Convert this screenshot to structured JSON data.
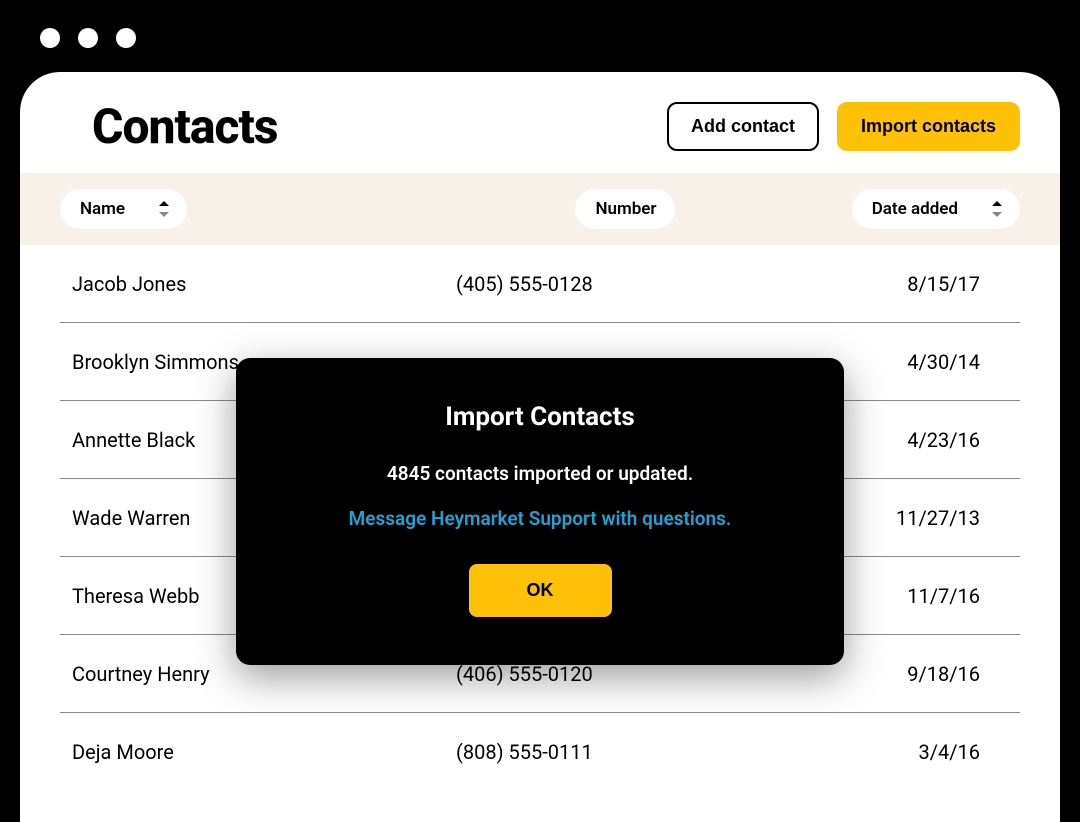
{
  "window": {
    "dots": 3
  },
  "header": {
    "title": "Contacts",
    "add_label": "Add contact",
    "import_label": "Import contacts"
  },
  "filters": {
    "name_label": "Name",
    "number_label": "Number",
    "date_label": "Date added"
  },
  "rows": [
    {
      "name": "Jacob Jones",
      "number": "(405) 555-0128",
      "date": "8/15/17"
    },
    {
      "name": "Brooklyn Simmons",
      "number": "",
      "date": "4/30/14"
    },
    {
      "name": "Annette Black",
      "number": "",
      "date": "4/23/16"
    },
    {
      "name": "Wade Warren",
      "number": "",
      "date": "11/27/13"
    },
    {
      "name": "Theresa Webb",
      "number": "",
      "date": "11/7/16"
    },
    {
      "name": "Courtney Henry",
      "number": "(406) 555-0120",
      "date": "9/18/16"
    },
    {
      "name": "Deja Moore",
      "number": "(808) 555-0111",
      "date": "3/4/16"
    }
  ],
  "modal": {
    "title": "Import Contacts",
    "body": "4845 contacts imported or updated.",
    "link": "Message Heymarket Support with questions.",
    "ok": "OK"
  }
}
